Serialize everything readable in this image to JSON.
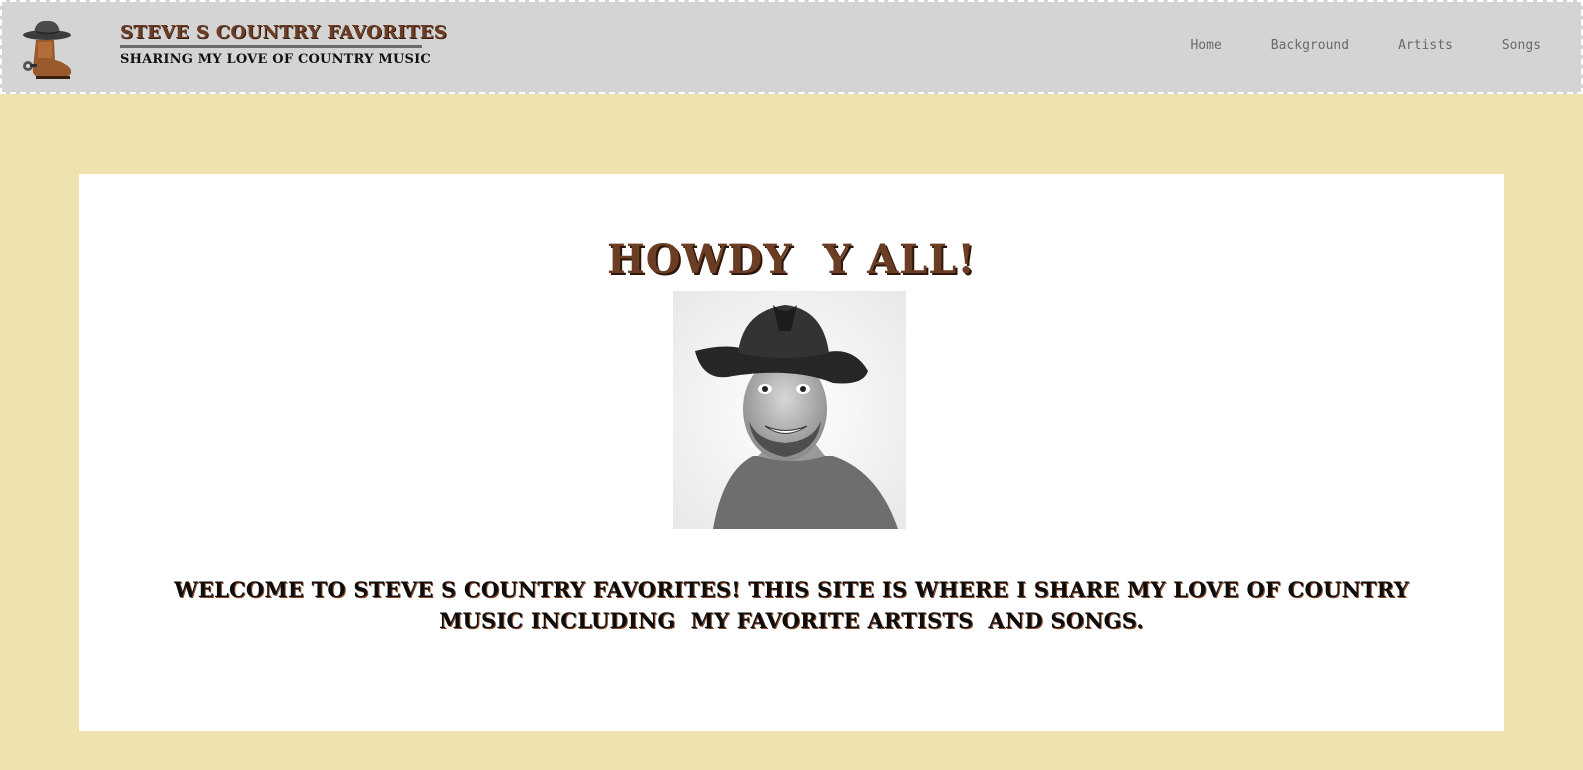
{
  "header": {
    "logo_icon": "cowboy-boot-hat-icon",
    "title": "STEVE S COUNTRY FAVORITES",
    "subtitle": "SHARING MY LOVE OF COUNTRY MUSIC",
    "nav": {
      "home": "Home",
      "background": "Background",
      "artists": "Artists",
      "songs": "Songs"
    }
  },
  "main": {
    "greeting": "HOWDY  Y ALL!",
    "photo_icon": "cowboy-portrait-icon",
    "welcome": "WELCOME TO STEVE S COUNTRY FAVORITES! THIS SITE IS WHERE I SHARE MY LOVE OF COUNTRY MUSIC INCLUDING  MY FAVORITE ARTISTS  AND SONGS."
  },
  "colors": {
    "page_background": "#eee3ae",
    "header_background": "#d4d4d4",
    "brand_brown": "#6b3d24",
    "content_background": "#ffffff"
  }
}
